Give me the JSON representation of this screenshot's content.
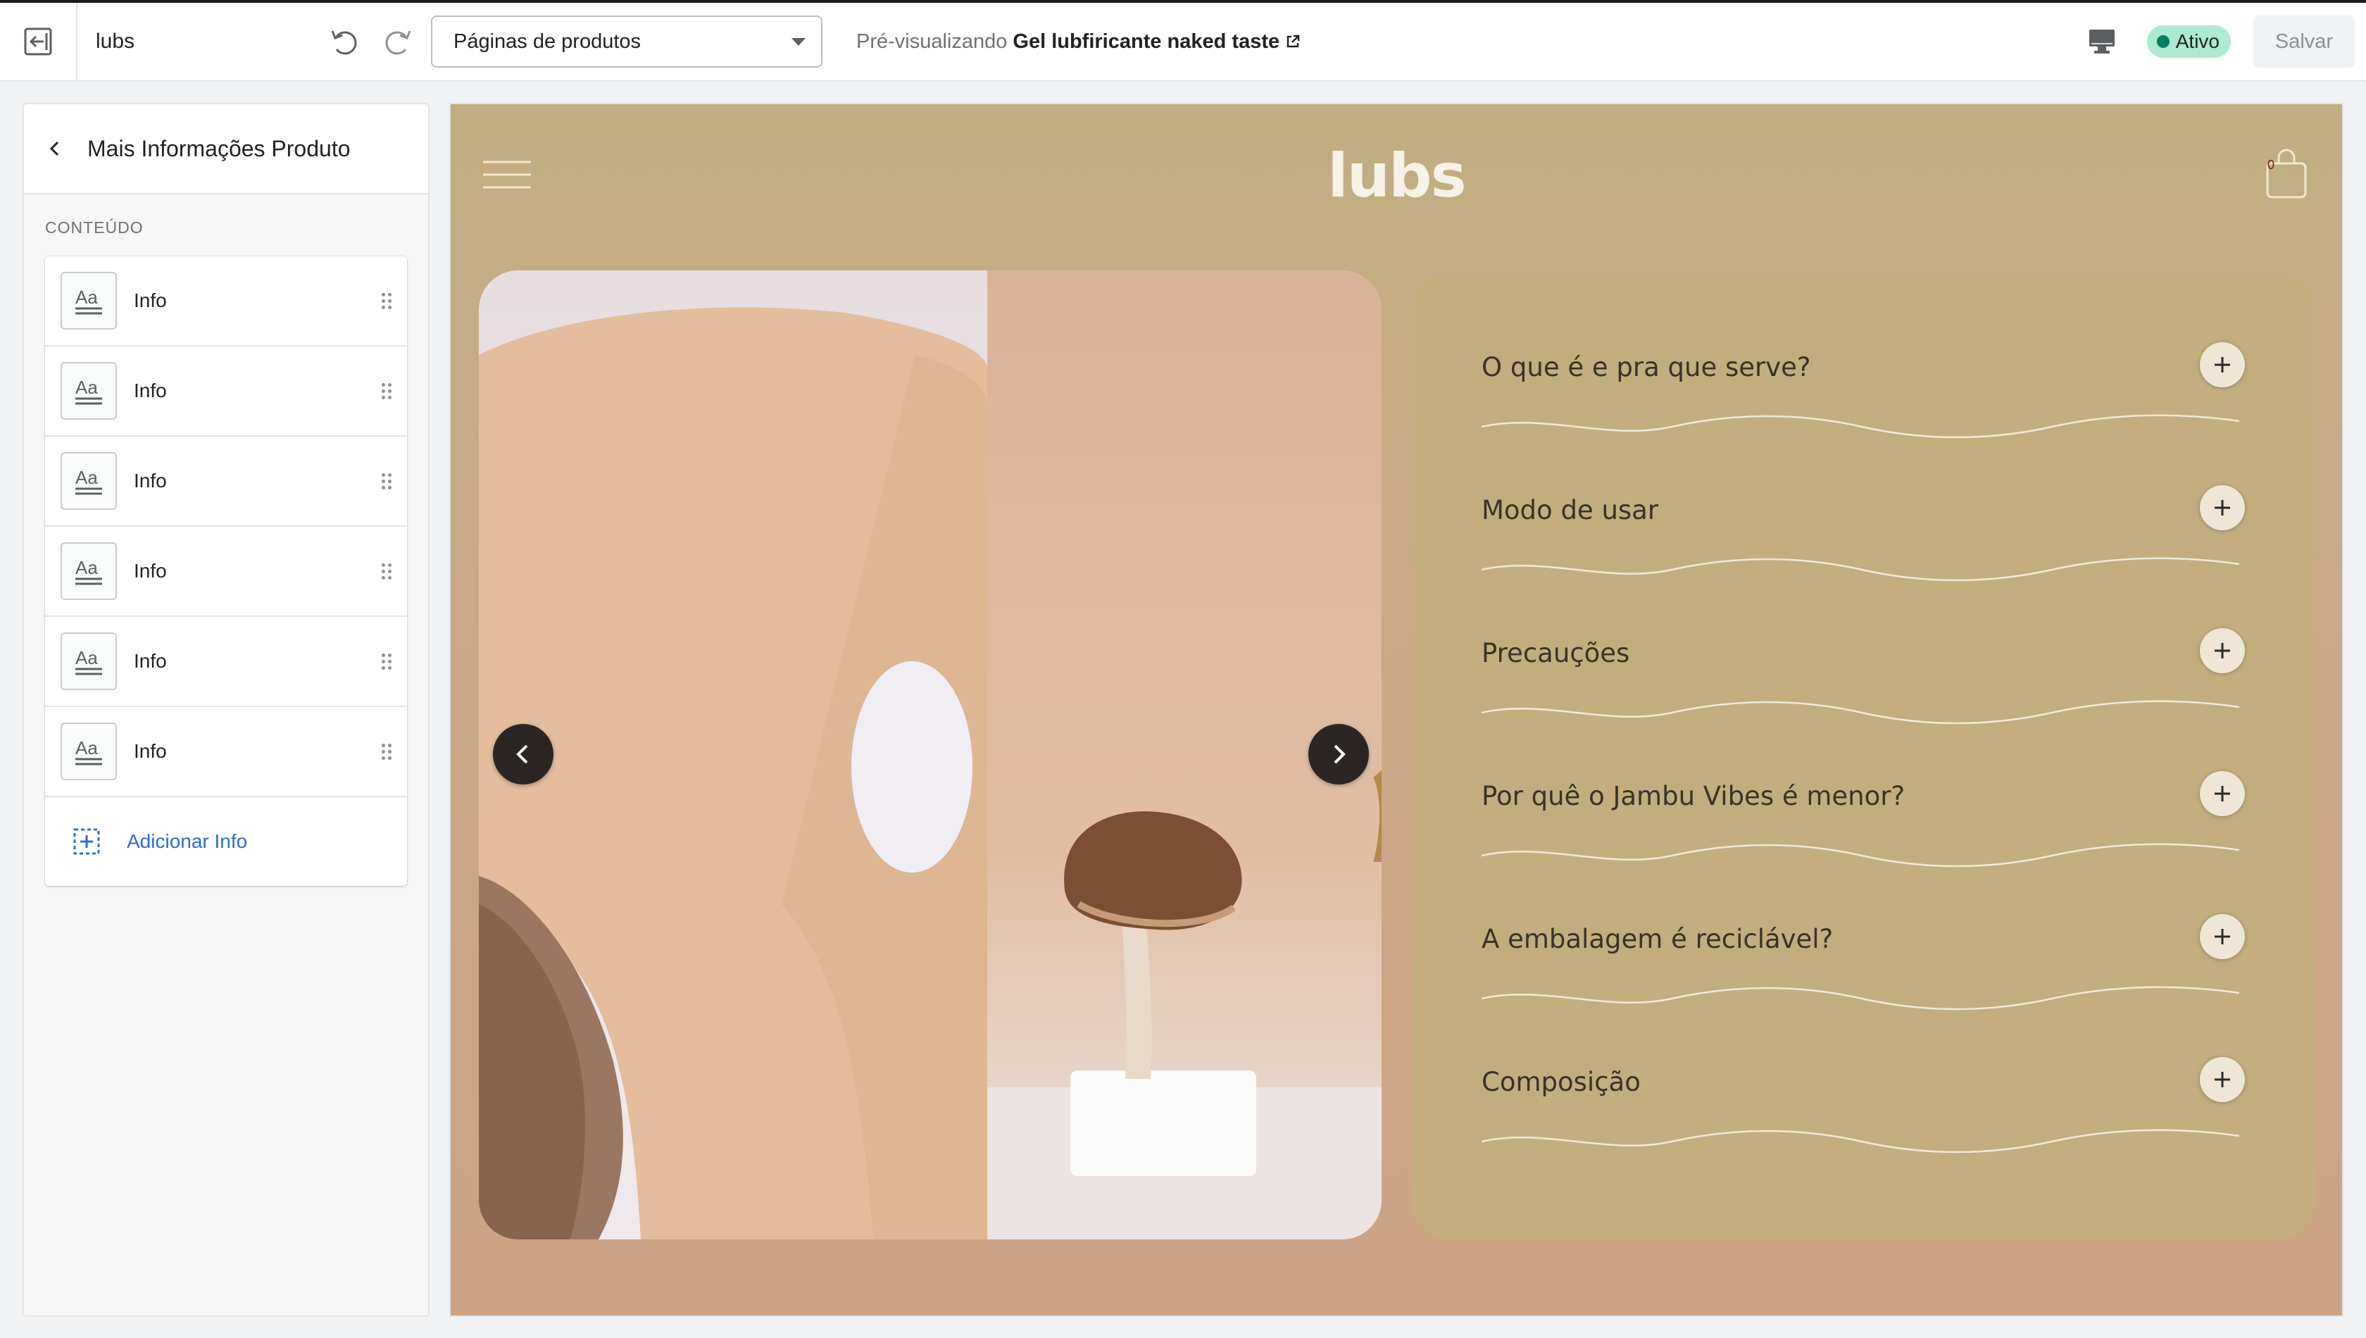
{
  "topbar": {
    "store_name": "lubs",
    "template_select": "Páginas de produtos",
    "preview_prefix": "Pré-visualizando",
    "preview_product": "Gel lubfiricante naked taste",
    "status": "Ativo",
    "save_label": "Salvar"
  },
  "sidebar": {
    "title": "Mais Informações Produto",
    "section_label": "CONTEÚDO",
    "items": [
      {
        "label": "Info"
      },
      {
        "label": "Info"
      },
      {
        "label": "Info"
      },
      {
        "label": "Info"
      },
      {
        "label": "Info"
      },
      {
        "label": "Info"
      }
    ],
    "add_label": "Adicionar Info"
  },
  "preview": {
    "logo": "lubs",
    "cart_count": "0",
    "accordion": [
      {
        "title": "O que é e pra que serve?"
      },
      {
        "title": "Modo de usar"
      },
      {
        "title": "Precauções"
      },
      {
        "title": "Por quê o Jambu Vibes é menor?"
      },
      {
        "title": "A embalagem é reciclável?"
      },
      {
        "title": "Composição"
      }
    ]
  },
  "colors": {
    "accent_link": "#2c6ecb",
    "status_bg": "#aee9d1",
    "status_dot": "#007f5f",
    "preview_bg": "#c9a987",
    "accordion_bg": "#c3ad7e"
  }
}
